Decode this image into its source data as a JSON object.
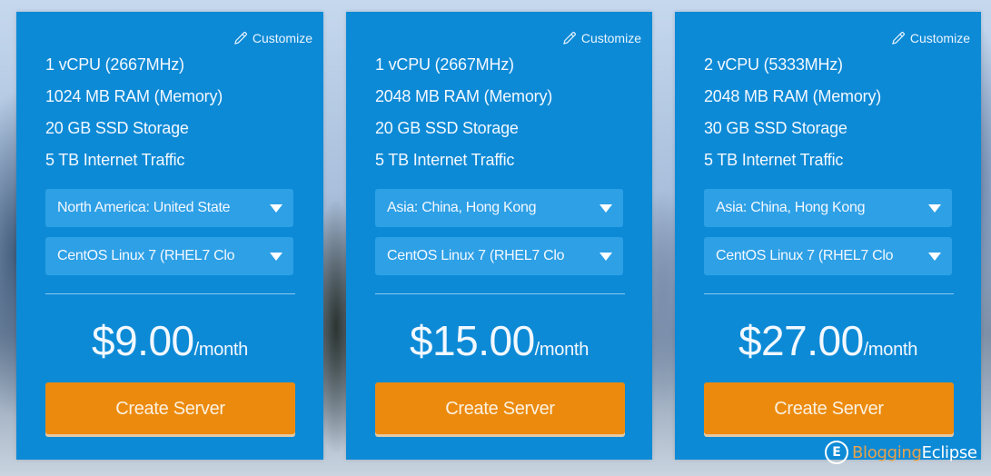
{
  "plans": [
    {
      "customize_label": "Customize",
      "specs": [
        "1 vCPU (2667MHz)",
        "1024 MB RAM (Memory)",
        "20 GB SSD Storage",
        "5 TB Internet Traffic"
      ],
      "region": "North America: United State",
      "os": "CentOS Linux 7 (RHEL7 Clo",
      "price": "$9.00",
      "period": "/month",
      "button_label": "Create Server"
    },
    {
      "customize_label": "Customize",
      "specs": [
        "1 vCPU (2667MHz)",
        "2048 MB RAM (Memory)",
        "20 GB SSD Storage",
        "5 TB Internet Traffic"
      ],
      "region": "Asia: China, Hong Kong",
      "os": "CentOS Linux 7 (RHEL7 Clo",
      "price": "$15.00",
      "period": "/month",
      "button_label": "Create Server"
    },
    {
      "customize_label": "Customize",
      "specs": [
        "2 vCPU (5333MHz)",
        "2048 MB RAM (Memory)",
        "30 GB SSD Storage",
        "5 TB Internet Traffic"
      ],
      "region": "Asia: China, Hong Kong",
      "os": "CentOS Linux 7 (RHEL7 Clo",
      "price": "$27.00",
      "period": "/month",
      "button_label": "Create Server"
    }
  ],
  "watermark": {
    "logo_letter": "E",
    "part1": "Blogging",
    "part2": "Eclipse"
  },
  "colors": {
    "card_bg": "#0d8ad6",
    "select_bg": "#2ea0e6",
    "button_bg": "#ec8a0d"
  }
}
